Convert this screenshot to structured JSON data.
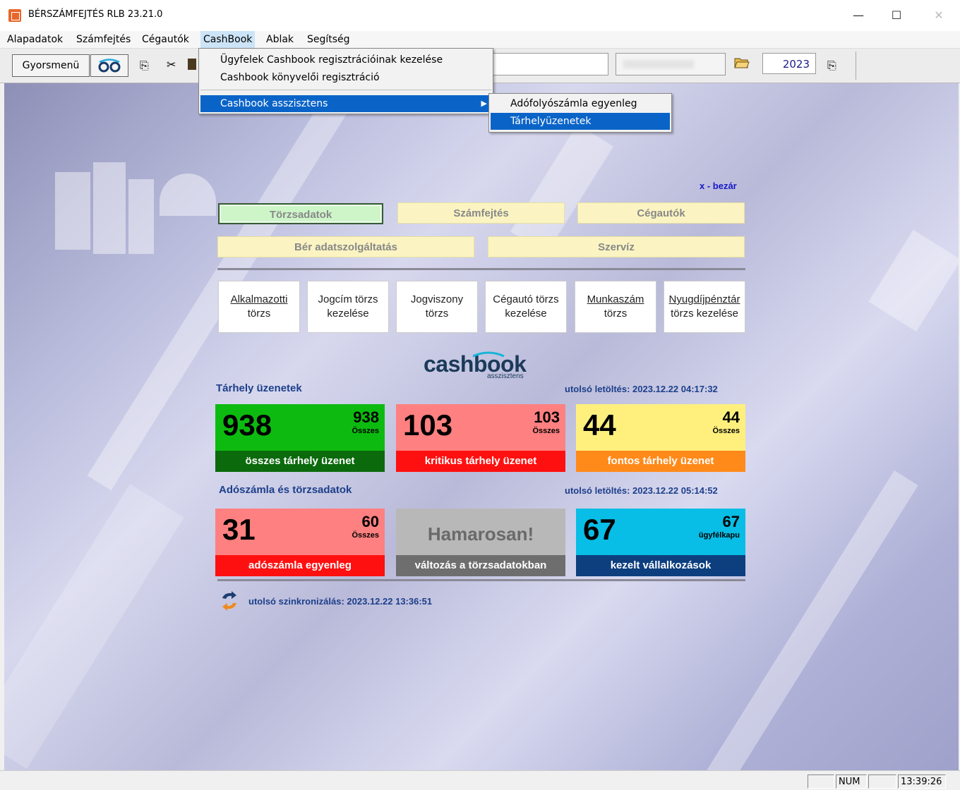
{
  "window": {
    "title": "BÉRSZÁMFEJTÉS RLB 23.21.0",
    "controls": {
      "minimize": "—",
      "maximize": "☐",
      "close": "✕"
    }
  },
  "menubar": {
    "items": [
      "Alapadatok",
      "Számfejtés",
      "Cégautók",
      "CashBook",
      "Ablak",
      "Segítség"
    ],
    "active": "CashBook"
  },
  "toolbar": {
    "gyorsmenu_label": "Gyorsmenü",
    "year": "2023"
  },
  "cashbook_menu": {
    "items": [
      "Ügyfelek Cashbook regisztrációinak kezelése",
      "Cashbook könyvelői regisztráció",
      "Cashbook asszisztens"
    ],
    "submenu_arrow": "▶",
    "submenu": [
      "Adófolyószámla egyenleg",
      "Tárhelyüzenetek"
    ]
  },
  "panel": {
    "close_label": "x - bezár",
    "nav_buttons": [
      "Törzsadatok",
      "Számfejtés",
      "Cégautók",
      "Bér adatszolgáltatás",
      "Szervíz"
    ],
    "quick_buttons": [
      {
        "line1": "Alkalmazotti",
        "line2": "törzs"
      },
      {
        "line1": "Jogcím törzs",
        "line2": "kezelése"
      },
      {
        "line1": "Jogviszony",
        "line2": "törzs"
      },
      {
        "line1": "Cégautó törzs",
        "line2": "kezelése"
      },
      {
        "line1": "Munkaszám",
        "line2": "törzs"
      },
      {
        "line1": "Nyugdíjpénztár",
        "line2": "törzs kezelése"
      }
    ]
  },
  "cashbook": {
    "logo": "cashbook",
    "logo_sub": "asszisztens",
    "section1": {
      "title": "Tárhely üzenetek",
      "date": "utolsó letöltés: 2023.12.22 04:17:32",
      "tiles": [
        {
          "big": "938",
          "small": "938",
          "sub": "Összes",
          "label": "összes tárhely üzenet",
          "bg": "#0dbb10",
          "bar": "#0b6a0c"
        },
        {
          "big": "103",
          "small": "103",
          "sub": "Összes",
          "label": "kritikus tárhely üzenet",
          "bg": "#ff8080",
          "bar": "#ff1010"
        },
        {
          "big": "44",
          "small": "44",
          "sub": "Összes",
          "label": "fontos tárhely üzenet",
          "bg": "#fff07e",
          "bar": "#ff8a1a"
        }
      ]
    },
    "section2": {
      "title": "Adószámla és törzsadatok",
      "date": "utolsó letöltés: 2023.12.22 05:14:52",
      "tiles": [
        {
          "big": "31",
          "small": "60",
          "sub": "Összes",
          "label": "adószámla egyenleg",
          "bg": "#ff8080",
          "bar": "#ff1010"
        },
        {
          "big": "Hamarosan!",
          "label": "változás a törzsadatokban",
          "bg": "#b8b8b8",
          "bar": "#6e6e6e"
        },
        {
          "big": "67",
          "small": "67",
          "sub": "ügyfélkapu",
          "label": "kezelt vállalkozások",
          "bg": "#08bde6",
          "bar": "#0d3f7e"
        }
      ]
    },
    "sync": "utolsó szinkronizálás: 2023.12.22 13:36:51"
  },
  "statusbar": {
    "num": "NUM",
    "time": "13:39:26"
  }
}
